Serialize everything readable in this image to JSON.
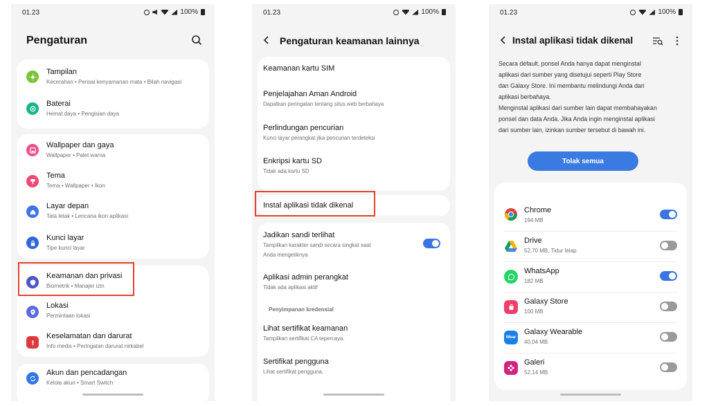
{
  "status": {
    "time": "01.23",
    "battery": "100%"
  },
  "screen1": {
    "title": "Pengaturan",
    "items": [
      {
        "title": "Tampilan",
        "subtitle": "Kecerahan  •  Perisai kenyamanan mata  •  Bilah navigasi",
        "icon": "display-icon",
        "color": "#7cc236"
      },
      {
        "title": "Baterai",
        "subtitle": "Hemat daya  •  Pengisian daya",
        "icon": "battery-icon",
        "color": "#19b58a"
      },
      {
        "title": "Wallpaper dan gaya",
        "subtitle": "Wallpaper  •  Palet warna",
        "icon": "wallpaper-icon",
        "color": "#e8538f"
      },
      {
        "title": "Tema",
        "subtitle": "Tema  •  Wallpaper  •  Ikon",
        "icon": "theme-icon",
        "color": "#ec4a76"
      },
      {
        "title": "Layar depan",
        "subtitle": "Tata letak  •  Lencana ikon aplikasi",
        "icon": "home-icon",
        "color": "#3f74e6"
      },
      {
        "title": "Kunci layar",
        "subtitle": "Tipe kunci layar",
        "icon": "lock-icon",
        "color": "#2f67d9"
      },
      {
        "title": "Keamanan dan privasi",
        "subtitle": "Biometrik  •  Manajer izin",
        "icon": "shield-icon",
        "color": "#4b56c7"
      },
      {
        "title": "Lokasi",
        "subtitle": "Permintaan lokasi",
        "icon": "location-icon",
        "color": "#5b6ae0"
      },
      {
        "title": "Keselamatan dan darurat",
        "subtitle": "Info medis  •  Peringatan darurat nirkabel",
        "icon": "emergency-icon",
        "color": "#dd3a3a"
      },
      {
        "title": "Akun dan pencadangan",
        "subtitle": "Kelola akun  •  Smart Switch",
        "icon": "sync-icon",
        "color": "#3376e6"
      }
    ]
  },
  "screen2": {
    "title": "Pengaturan keamanan lainnya",
    "items": [
      {
        "title": "Keamanan kartu SIM",
        "subtitle": ""
      },
      {
        "title": "Penjelajahan Aman Android",
        "subtitle": "Dapatkan peringatan tentang situs web berbahaya"
      },
      {
        "title": "Perlindungan pencurian",
        "subtitle": "Kunci layar perangkat jika pencurian terdeteksi"
      },
      {
        "title": "Enkripsi kartu SD",
        "subtitle": "Tidak ada kartu SD"
      },
      {
        "title": "Instal aplikasi tidak dikenal",
        "subtitle": ""
      },
      {
        "title": "Jadikan sandi terlihat",
        "subtitle_line1": "Tampilkan karakter sandi secara singkat saat",
        "subtitle_line2": "Anda mengetiknya",
        "toggle": true
      },
      {
        "title": "Aplikasi admin perangkat",
        "subtitle": "Tidak ada aplikasi aktif"
      },
      {
        "title": "Lihat sertifikat keamanan",
        "subtitle": "Tampilkan sertifikat CA tepercaya."
      },
      {
        "title": "Sertifikat pengguna",
        "subtitle": "Lihat sertifikat pengguna."
      }
    ],
    "section_header": "Penyimpanan kredensial"
  },
  "screen3": {
    "title": "Instal aplikasi tidak dikenal",
    "description_lines": [
      "Secara default, ponsel Anda hanya dapat menginstal",
      "aplikasi dari sumber yang disetujui seperti Play Store",
      "dan Galaxy Store. Ini membantu melindungi Anda dari",
      "aplikasi berbahaya.",
      "Menginstal aplikasi dari sumber lain dapat membahayakan",
      "ponsel dan data Anda. Jika Anda ingin menginstal aplikasi",
      "dari sumber lain, izinkan sumber tersebut di bawah ini."
    ],
    "button": "Tolak semua",
    "apps": [
      {
        "name": "Chrome",
        "detail": "194 MB",
        "enabled": true,
        "icon": "chrome-icon"
      },
      {
        "name": "Drive",
        "detail": "52,70 MB, Tidur lelap",
        "enabled": false,
        "icon": "drive-icon"
      },
      {
        "name": "WhatsApp",
        "detail": "182 MB",
        "enabled": true,
        "icon": "whatsapp-icon",
        "color": "#25d366"
      },
      {
        "name": "Galaxy Store",
        "detail": "100 MB",
        "enabled": false,
        "icon": "galaxy-store-icon",
        "color": "#ee3f6a"
      },
      {
        "name": "Galaxy Wearable",
        "detail": "40,04 MB",
        "enabled": false,
        "icon": "galaxy-wearable-icon",
        "icon_text": "Wear",
        "color": "#1a7fe6"
      },
      {
        "name": "Galeri",
        "detail": "52,14 MB",
        "enabled": false,
        "icon": "gallery-icon",
        "color": "#d4237e"
      }
    ]
  },
  "colors": {
    "accent": "#3a75e3",
    "highlight": "#e4412b"
  }
}
